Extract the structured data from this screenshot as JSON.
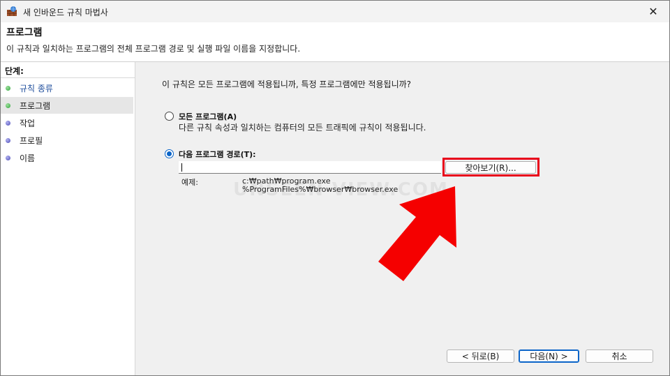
{
  "window": {
    "title": "새 인바운드 규칙 마법사",
    "close_glyph": "✕"
  },
  "header": {
    "title": "프로그램",
    "description": "이 규칙과 일치하는 프로그램의 전체 프로그램 경로 및 실행 파일 이름을 지정합니다."
  },
  "sidebar": {
    "steps_label": "단계:",
    "items": [
      {
        "label": "규칙 종류",
        "dot": "green"
      },
      {
        "label": "프로그램",
        "dot": "green"
      },
      {
        "label": "작업",
        "dot": "blue"
      },
      {
        "label": "프로필",
        "dot": "blue"
      },
      {
        "label": "이름",
        "dot": "blue"
      }
    ]
  },
  "content": {
    "question": "이 규칙은 모든 프로그램에 적용됩니까, 특정 프로그램에만 적용됩니까?",
    "option_all": {
      "label": "모든 프로그램(A)",
      "description": "다른 규칙 속성과 일치하는 컴퓨터의 모든 트래픽에 규칙이 적용됩니다.",
      "selected": false
    },
    "option_path": {
      "label": "다음 프로그램 경로(T):",
      "selected": true
    },
    "path_input": {
      "value": ""
    },
    "browse_button": "찾아보기(R)...",
    "example_label": "예제:",
    "example_lines": [
      "c:₩path₩program.exe",
      "%ProgramFiles%₩browser₩browser.exe"
    ],
    "watermark": "UNSEEN-VIEW.COM"
  },
  "footer": {
    "back": "< 뒤로(B)",
    "next": "다음(N) >",
    "cancel": "취소"
  },
  "colors": {
    "highlight": "#e8001a",
    "accent": "#0a64c8"
  }
}
